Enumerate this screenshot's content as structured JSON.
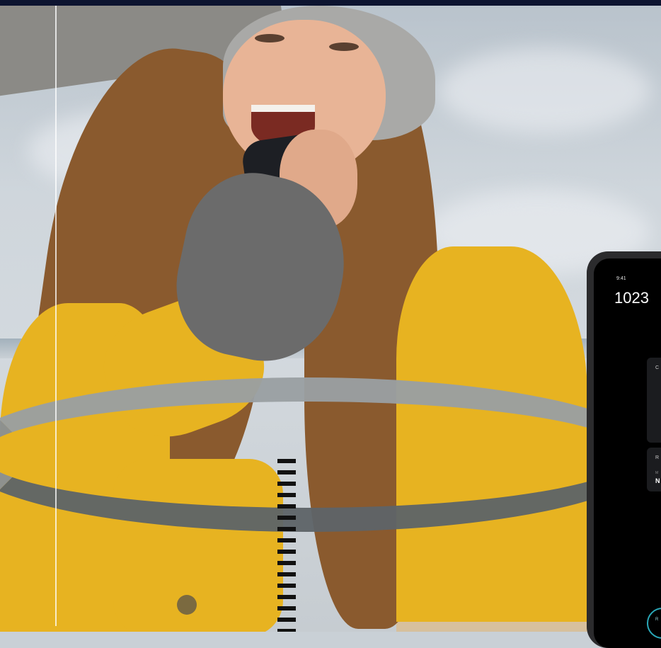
{
  "device": {
    "status_time": "9:41",
    "clock": "1023",
    "card1_label": "C",
    "card2_label": "R",
    "card2_sub": "M",
    "card2_value": "N",
    "ring_label": "R"
  },
  "colors": {
    "jacket": "#e7b321",
    "accent_ring": "#2aa8b8",
    "topbar": "#0d1430"
  }
}
